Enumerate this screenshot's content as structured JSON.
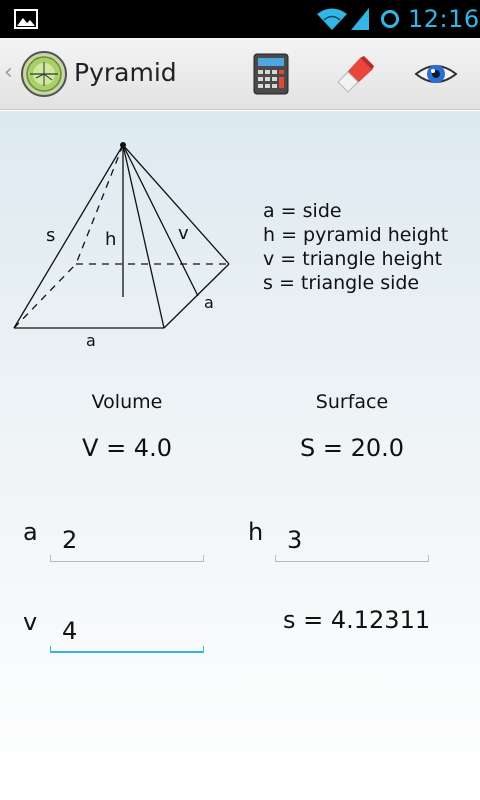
{
  "status_bar": {
    "time": "12:16",
    "accent": "#33b5e5"
  },
  "action_bar": {
    "title": "Pyramid",
    "icons": [
      "gallery-icon",
      "app-level-icon",
      "calculator-icon",
      "eraser-icon",
      "eye-icon"
    ]
  },
  "diagram": {
    "labels": {
      "s": "s",
      "h": "h",
      "v": "v",
      "a_base": "a",
      "a_side": "a"
    }
  },
  "legend": [
    "a = side",
    "h = pyramid height",
    "v = triangle height",
    "s = triangle side"
  ],
  "results": {
    "volume_label": "Volume",
    "volume_value": "V = 4.0",
    "surface_label": "Surface",
    "surface_value": "S = 20.0"
  },
  "inputs": {
    "a": {
      "label": "a",
      "value": "2"
    },
    "h": {
      "label": "h",
      "value": "3"
    },
    "v": {
      "label": "v",
      "value": "4"
    }
  },
  "computed": {
    "s_text": "s = 4.12311"
  }
}
